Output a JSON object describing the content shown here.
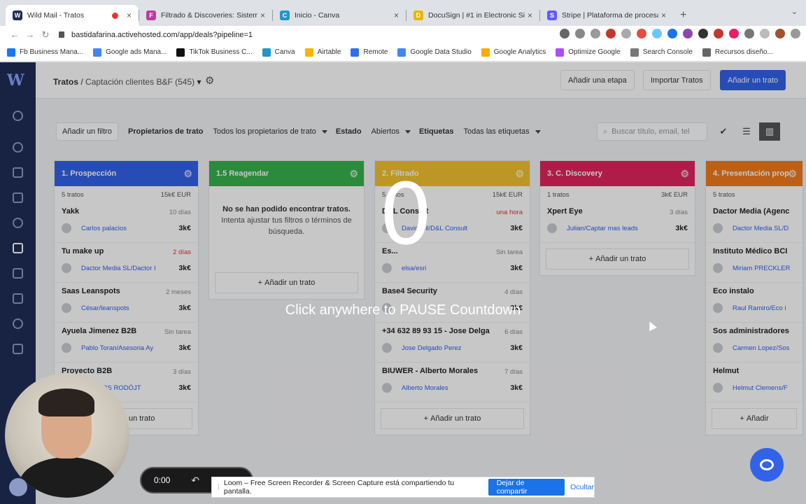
{
  "tabs": [
    {
      "title": "Wild Mail - Tratos",
      "fav_color": "#1f2d57",
      "fav": "W",
      "active": true
    },
    {
      "title": "Filtrado & Discoveries: Sistema",
      "fav_color": "#c038a0",
      "fav": "F",
      "active": false
    },
    {
      "title": "Inicio - Canva",
      "fav_color": "#1f97c7",
      "fav": "C",
      "active": false
    },
    {
      "title": "DocuSign | #1 in Electronic Sig",
      "fav_color": "#e6b800",
      "fav": "D",
      "active": false
    },
    {
      "title": "Stripe | Plataforma de procesa",
      "fav_color": "#635bff",
      "fav": "S",
      "active": false
    }
  ],
  "address": {
    "url": "bastidafarina.activehosted.com/app/deals?pipeline=1"
  },
  "bookmarks": [
    {
      "label": "Fb Business Mana...",
      "color": "#1877f2"
    },
    {
      "label": "Google ads Mana...",
      "color": "#4285f4"
    },
    {
      "label": "TikTok Business C...",
      "color": "#111111"
    },
    {
      "label": "Canva",
      "color": "#1f97c7"
    },
    {
      "label": "Airtable",
      "color": "#f8b400"
    },
    {
      "label": "Remote",
      "color": "#2f6fed"
    },
    {
      "label": "Google Data Studio",
      "color": "#4285f4"
    },
    {
      "label": "Google Analytics",
      "color": "#f9ab00"
    },
    {
      "label": "Optimize Google",
      "color": "#b04cff"
    },
    {
      "label": "Search Console",
      "color": "#777777"
    },
    {
      "label": "Recursos diseño...",
      "color": "#666666"
    }
  ],
  "header": {
    "crumb_root": "Tratos",
    "crumb_sep": "/",
    "crumb_sub": "Captación clientes B&F (545)",
    "add_stage": "Añadir una etapa",
    "import": "Importar Tratos",
    "add_deal": "Añadir un trato"
  },
  "filters": {
    "add_filter": "Añadir un filtro",
    "owners_label": "Propietarios de trato",
    "owners_value": "Todos los propietarios de trato",
    "status_label": "Estado",
    "status_value": "Abiertos",
    "tags_label": "Etiquetas",
    "tags_value": "Todas las etiquetas",
    "search_placeholder": "Buscar título, email, tel"
  },
  "columns": [
    {
      "title": "1. Prospección",
      "color": "#3262e8",
      "count": "5 tratos",
      "total": "15k€ EUR",
      "cards": [
        {
          "title": "Yakk",
          "date": "10 días",
          "user": "Carlos palacios",
          "value": "3k€",
          "red": false
        },
        {
          "title": "Tu make up",
          "date": "2 días",
          "user": "Dactor Media SL/Dactor I",
          "value": "3k€",
          "red": true
        },
        {
          "title": "Saas Leanspots",
          "date": "2 meses",
          "user": "César/leanspots",
          "value": "3k€",
          "red": false
        },
        {
          "title": "Ayuela Jimenez B2B",
          "date": "Sin tarea",
          "user": "Pablo Toran/Asesoria Ay",
          "value": "3k€",
          "red": false
        },
        {
          "title": "Proyecto B2B",
          "date": "3 días",
          "user": "...ORMOS RODÓJT",
          "value": "3k€",
          "red": false
        }
      ],
      "add": "Añadir un trato"
    },
    {
      "title": "1.5 Reagendar",
      "color": "#37b24d",
      "count": "",
      "total": "",
      "empty_title": "No se han podido encontrar tratos.",
      "empty_body": "Intenta ajustar tus filtros o términos de búsqueda.",
      "cards": [],
      "add": "Añadir un trato"
    },
    {
      "title": "2. Filtrado",
      "color": "#f2c230",
      "count": "5 tratos",
      "total": "15k€ EUR",
      "cards": [
        {
          "title": "D&L Consult",
          "date": "una hora",
          "user": "David Gil/D&L Consult",
          "value": "3k€",
          "red": true
        },
        {
          "title": "Es...",
          "date": "Sin tarea",
          "user": "elsa/esri",
          "value": "3k€",
          "red": false
        },
        {
          "title": "Base4 Security",
          "date": "4 días",
          "user": "",
          "value": "3k€",
          "red": false
        },
        {
          "title": "+34 632 89 93 15 - Jose Delga",
          "date": "6 días",
          "user": "Jose Delgado Perez",
          "value": "3k€",
          "red": false
        },
        {
          "title": "BIUWER - Alberto Morales",
          "date": "7 días",
          "user": "Alberto Morales",
          "value": "3k€",
          "red": false
        }
      ],
      "add": "Añadir un trato"
    },
    {
      "title": "3. C. Discovery",
      "color": "#e0245e",
      "count": "1 tratos",
      "total": "3k€ EUR",
      "cards": [
        {
          "title": "Xpert Eye",
          "date": "3 días",
          "user": "Julian/Captar mas leads",
          "value": "3k€",
          "red": false
        }
      ],
      "add": "Añadir un trato"
    },
    {
      "title": "4. Presentación prop",
      "color": "#f07c1b",
      "count": "5 tratos",
      "total": "",
      "cards": [
        {
          "title": "Dactor Media (Agenc",
          "date": "",
          "user": "Dactor Media SL/D",
          "value": "",
          "red": false
        },
        {
          "title": "Instituto Médico BCI",
          "date": "",
          "user": "Miriam PRECKLER",
          "value": "",
          "red": false
        },
        {
          "title": "Eco instalo",
          "date": "",
          "user": "Raul Ramiro/Eco i",
          "value": "",
          "red": false
        },
        {
          "title": "Sos administradores",
          "date": "",
          "user": "Carmen Lopez/Sos",
          "value": "",
          "red": false
        },
        {
          "title": "Helmut",
          "date": "",
          "user": "Helmut Clemens/F",
          "value": "",
          "red": false
        }
      ],
      "add": "Añadir"
    }
  ],
  "overlay": {
    "countdown": "0",
    "message": "Click anywhere to PAUSE Countdown"
  },
  "recorder": {
    "time": "0:00"
  },
  "loom": {
    "message": "Loom – Free Screen Recorder & Screen Capture está compartiendo tu pantalla.",
    "stop": "Dejar de compartir",
    "hide": "Ocultar"
  }
}
